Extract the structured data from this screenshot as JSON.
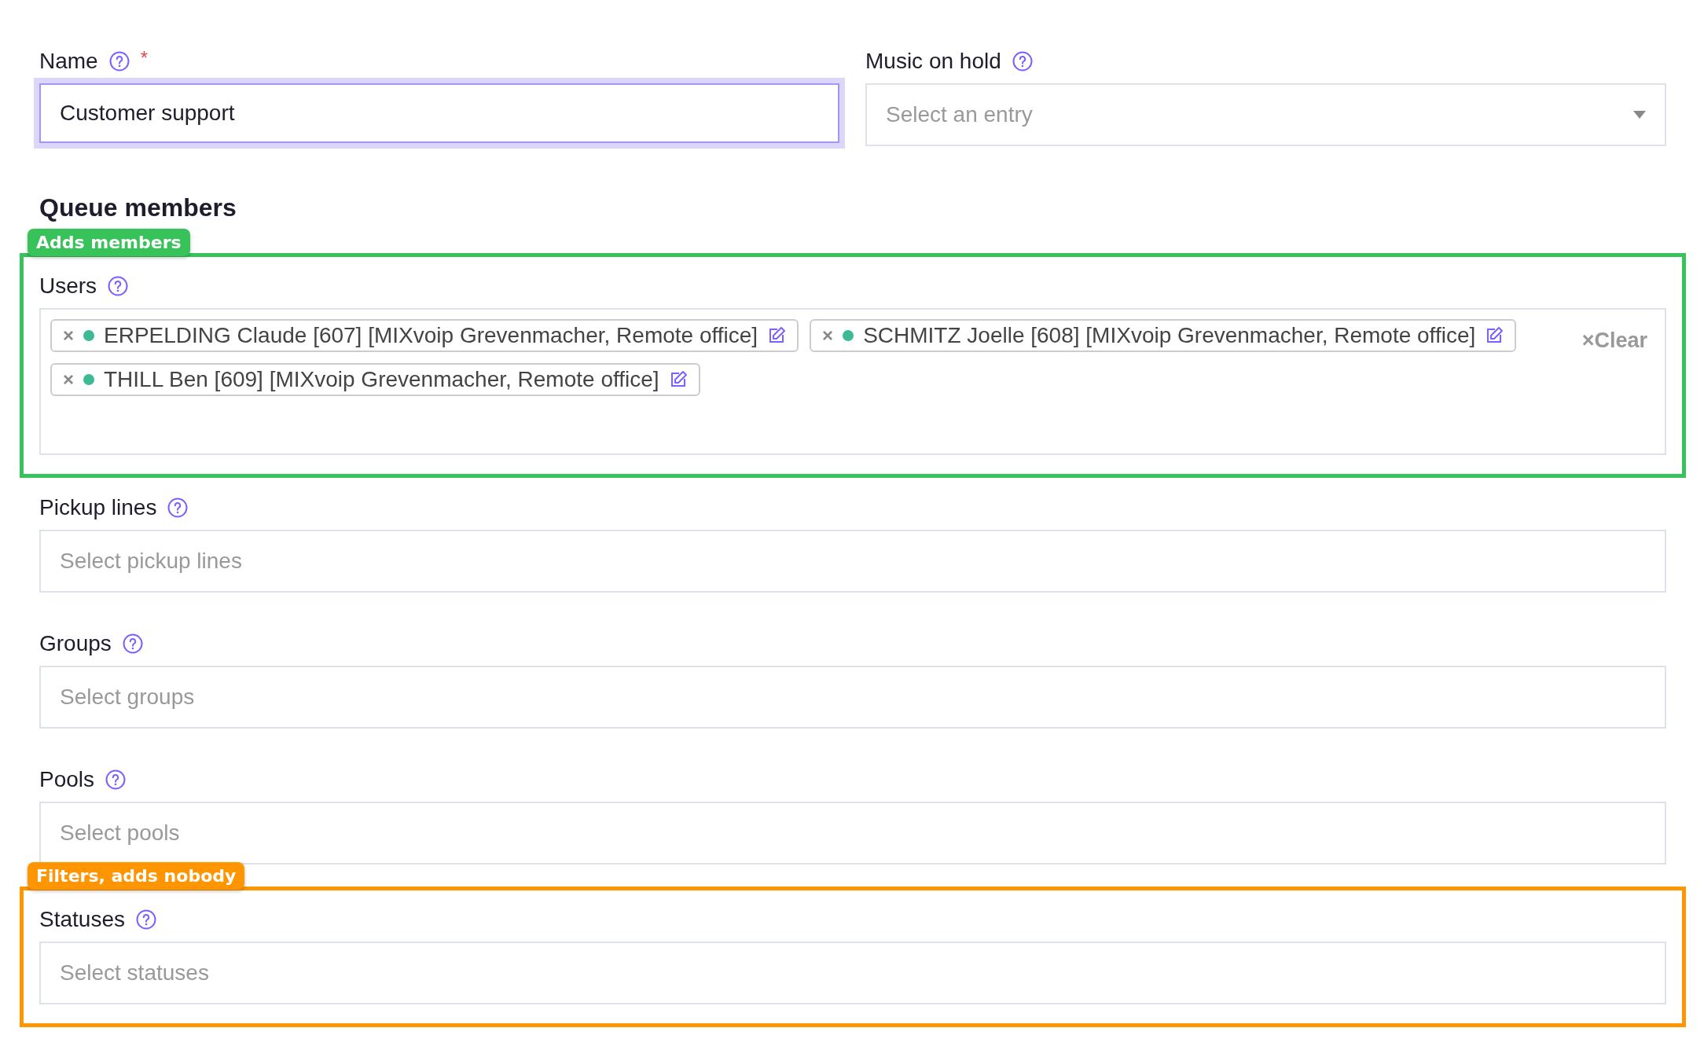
{
  "top_fields": [
    {
      "label": "Name",
      "required_mark": "*",
      "kind": "text",
      "value": "Customer support",
      "focused": true
    },
    {
      "label": "Music on hold",
      "kind": "select",
      "placeholder": "Select an entry",
      "focused": false
    }
  ],
  "heading": "Queue members",
  "member_fields": [
    {
      "label": "Users",
      "kind": "tags",
      "clear": "×Clear",
      "annotation": {
        "label": "Adds members",
        "color": "#37c25a"
      },
      "tags": [
        {
          "remove": "×",
          "text": "ERPELDING Claude [607] [MIXvoip Grevenmacher, Remote office]"
        },
        {
          "remove": "×",
          "text": "SCHMITZ Joelle [608] [MIXvoip Grevenmacher, Remote office]"
        },
        {
          "remove": "×",
          "text": "THILL Ben [609] [MIXvoip Grevenmacher, Remote office]"
        }
      ]
    },
    {
      "label": "Pickup lines",
      "kind": "multiselect",
      "placeholder": "Select pickup lines"
    },
    {
      "label": "Groups",
      "kind": "multiselect",
      "placeholder": "Select groups"
    },
    {
      "label": "Pools",
      "kind": "multiselect",
      "placeholder": "Select pools"
    },
    {
      "label": "Statuses",
      "kind": "multiselect",
      "placeholder": "Select statuses",
      "annotation": {
        "label": "Filters, adds nobody",
        "color": "#ff9500"
      }
    }
  ]
}
